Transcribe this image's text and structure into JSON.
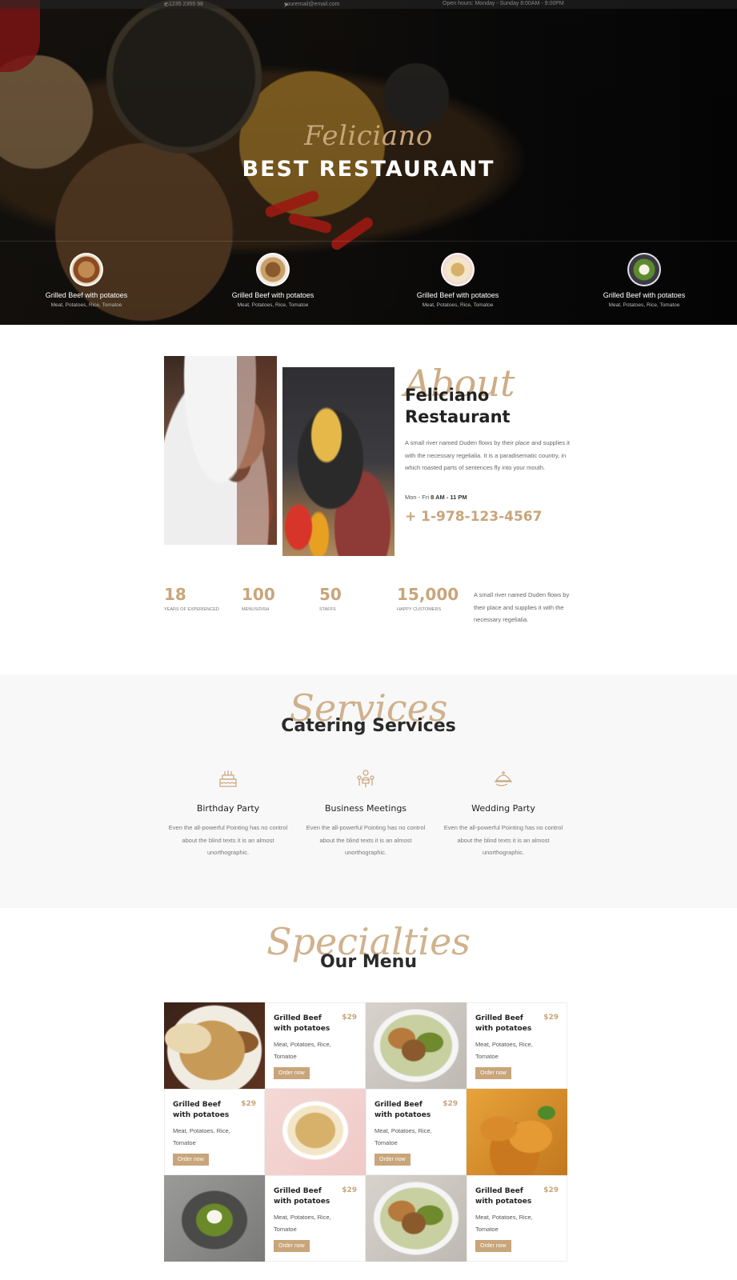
{
  "topbar": {
    "phone": "+ 1235 2355 98",
    "email": "youremail@email.com",
    "hours": "Open hours: Monday - Sunday 8:00AM - 9:00PM"
  },
  "hero": {
    "script": "Feliciano",
    "title": "BEST RESTAURANT",
    "dishes": [
      {
        "name": "Grilled Beef with potatoes",
        "ingredients": "Meat, Potatoes, Rice, Tomatoe"
      },
      {
        "name": "Grilled Beef with potatoes",
        "ingredients": "Meat, Potatoes, Rice, Tomatoe"
      },
      {
        "name": "Grilled Beef with potatoes",
        "ingredients": "Meat, Potatoes, Rice, Tomatoe"
      },
      {
        "name": "Grilled Beef with potatoes",
        "ingredients": "Meat, Potatoes, Rice, Tomatoe"
      }
    ]
  },
  "about": {
    "script": "About",
    "title_line1": "Feliciano",
    "title_line2": "Restaurant",
    "text": "A small river named Duden flows by their place and supplies it with the necessary regelialia. It is a paradisematic country, in which roasted parts of sentences fly into your mouth.",
    "hours_label": "Mon - Fri",
    "hours_value": "8 AM - 11 PM",
    "phone": "+ 1-978-123-4567"
  },
  "stats": [
    {
      "value": "18",
      "label": "Years of Experienced"
    },
    {
      "value": "100",
      "label": "Menus/Dish"
    },
    {
      "value": "50",
      "label": "Staffs"
    },
    {
      "value": "15,000",
      "label": "Happy Customers"
    }
  ],
  "stats_text": "A small river named Duden flows by their place and supplies it with the necessary regelialia.",
  "services": {
    "script": "Services",
    "title": "Catering Services",
    "items": [
      {
        "title": "Birthday Party",
        "text": "Even the all-powerful Pointing has no control about the blind texts it is an almost unorthographic.",
        "icon": "birthday-cake-icon"
      },
      {
        "title": "Business Meetings",
        "text": "Even the all-powerful Pointing has no control about the blind texts it is an almost unorthographic.",
        "icon": "meeting-icon"
      },
      {
        "title": "Wedding Party",
        "text": "Even the all-powerful Pointing has no control about the blind texts it is an almost unorthographic.",
        "icon": "serving-dish-icon"
      }
    ]
  },
  "menu": {
    "script": "Specialties",
    "title": "Our Menu",
    "items": [
      {
        "name": "Grilled Beef with potatoes",
        "price": "$29",
        "ingredients": "Meat, Potatoes, Rice, Tomatoe",
        "button": "Order now"
      },
      {
        "name": "Grilled Beef with potatoes",
        "price": "$29",
        "ingredients": "Meat, Potatoes, Rice, Tomatoe",
        "button": "Order now"
      },
      {
        "name": "Grilled Beef with potatoes",
        "price": "$29",
        "ingredients": "Meat, Potatoes, Rice, Tomatoe",
        "button": "Order now"
      },
      {
        "name": "Grilled Beef with potatoes",
        "price": "$29",
        "ingredients": "Meat, Potatoes, Rice, Tomatoe",
        "button": "Order now"
      },
      {
        "name": "Grilled Beef with potatoes",
        "price": "$29",
        "ingredients": "Meat, Potatoes, Rice, Tomatoe",
        "button": "Order now"
      },
      {
        "name": "Grilled Beef with potatoes",
        "price": "$29",
        "ingredients": "Meat, Potatoes, Rice, Tomatoe",
        "button": "Order now"
      }
    ]
  },
  "colors": {
    "accent": "#c8a57a",
    "dark": "#222222",
    "muted": "#777777",
    "section_bg": "#f8f8f8"
  }
}
